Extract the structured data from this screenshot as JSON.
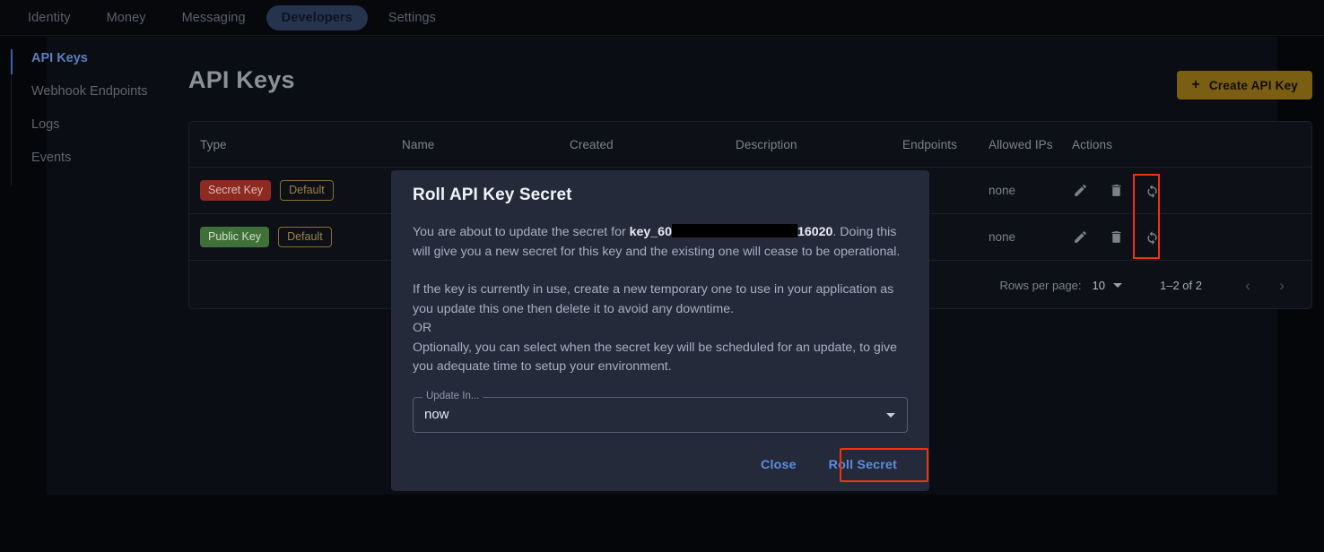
{
  "topnav": {
    "items": [
      {
        "label": "Identity",
        "active": false
      },
      {
        "label": "Money",
        "active": false
      },
      {
        "label": "Messaging",
        "active": false
      },
      {
        "label": "Developers",
        "active": true
      },
      {
        "label": "Settings",
        "active": false
      }
    ]
  },
  "sidebar": {
    "items": [
      {
        "label": "API Keys",
        "active": true
      },
      {
        "label": "Webhook Endpoints",
        "active": false
      },
      {
        "label": "Logs",
        "active": false
      },
      {
        "label": "Events",
        "active": false
      }
    ]
  },
  "header": {
    "title": "API Keys",
    "create_button": "Create API Key",
    "create_button_icon": "plus-icon"
  },
  "table": {
    "columns": [
      "Type",
      "Name",
      "Created",
      "Description",
      "Endpoints",
      "Allowed IPs",
      "Actions"
    ],
    "rows": [
      {
        "type_badge": "Secret Key",
        "default_badge": "Default",
        "name": "",
        "created": "",
        "description": "",
        "endpoints": "",
        "allowed_ips": "none",
        "actions": [
          "edit-icon",
          "delete-icon",
          "roll-secret-icon"
        ]
      },
      {
        "type_badge": "Public Key",
        "default_badge": "Default",
        "name": "",
        "created": "",
        "description": "",
        "endpoints": "",
        "allowed_ips": "none",
        "actions": [
          "edit-icon",
          "delete-icon",
          "roll-secret-icon"
        ]
      }
    ],
    "pagination": {
      "rows_per_page_label": "Rows per page:",
      "rows_per_page_value": "10",
      "range": "1–2 of 2",
      "prev_icon": "‹",
      "next_icon": "›"
    }
  },
  "dialog": {
    "title": "Roll API Key Secret",
    "intro_prefix": "You are about to update the secret for ",
    "key_prefix": "key_60",
    "key_suffix": "16020",
    "intro_suffix": ". Doing this will give you a new secret for this key and the existing one will cease to be operational.",
    "paragraph2_line1": "If the key is currently in use, create a new temporary one to use in your application as you update this one then delete it to avoid any downtime.",
    "paragraph2_line2": "OR",
    "paragraph2_line3": "Optionally, you can select when the secret key will be scheduled for an update, to give you adequate time to setup your environment.",
    "field": {
      "label": "Update In...",
      "value": "now",
      "caret_icon": "chevron-down-icon"
    },
    "close_button": "Close",
    "confirm_button": "Roll Secret"
  },
  "colors": {
    "page_background": "#050609",
    "panel_background": "#0b0d14",
    "dialog_background": "#252a3a",
    "accent_blue": "#5b8dde",
    "accent_gold": "#7a5e12",
    "badge_secret": "#8d2b23",
    "badge_public": "#3f7038",
    "highlight_red": "#f0330a"
  }
}
